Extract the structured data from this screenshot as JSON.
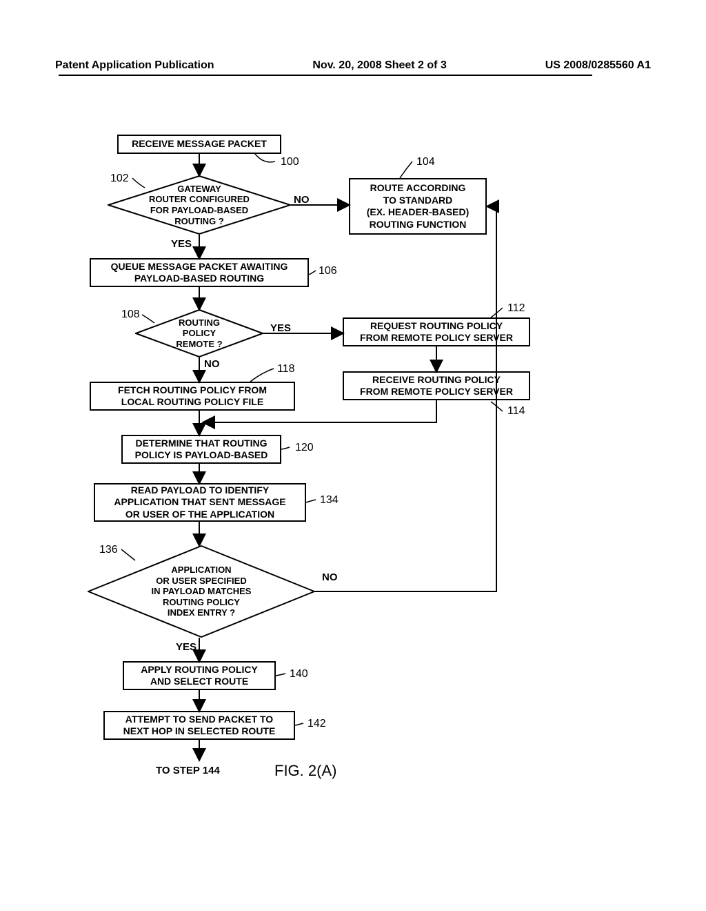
{
  "header": {
    "left": "Patent Application Publication",
    "center": "Nov. 20, 2008  Sheet 2 of 3",
    "right": "US 2008/0285560 A1"
  },
  "nodes": {
    "n100": "RECEIVE MESSAGE PACKET",
    "n102": "GATEWAY\nROUTER CONFIGURED\nFOR PAYLOAD-BASED\nROUTING ?",
    "n104": "ROUTE ACCORDING\nTO STANDARD\n(EX. HEADER-BASED)\nROUTING FUNCTION",
    "n106": "QUEUE MESSAGE PACKET AWAITING\nPAYLOAD-BASED ROUTING",
    "n108": "ROUTING\nPOLICY\nREMOTE ?",
    "n112": "REQUEST ROUTING POLICY\nFROM REMOTE POLICY SERVER",
    "n114": "RECEIVE ROUTING POLICY\nFROM REMOTE POLICY SERVER",
    "n118": "FETCH ROUTING POLICY FROM\nLOCAL ROUTING POLICY FILE",
    "n120": "DETERMINE THAT ROUTING\nPOLICY IS PAYLOAD-BASED",
    "n134": "READ PAYLOAD TO IDENTIFY\nAPPLICATION THAT SENT MESSAGE\nOR USER OF THE APPLICATION",
    "n136": "APPLICATION\nOR USER SPECIFIED\nIN PAYLOAD MATCHES\nROUTING POLICY\nINDEX ENTRY ?",
    "n140": "APPLY ROUTING POLICY\nAND SELECT ROUTE",
    "n142": "ATTEMPT TO SEND PACKET TO\nNEXT HOP IN SELECTED ROUTE",
    "end": "TO STEP 144"
  },
  "labels": {
    "yes": "YES",
    "no": "NO"
  },
  "refs": {
    "r100": "100",
    "r102": "102",
    "r104": "104",
    "r106": "106",
    "r108": "108",
    "r112": "112",
    "r114": "114",
    "r118": "118",
    "r120": "120",
    "r134": "134",
    "r136": "136",
    "r140": "140",
    "r142": "142"
  },
  "figure": "FIG. 2(A)"
}
